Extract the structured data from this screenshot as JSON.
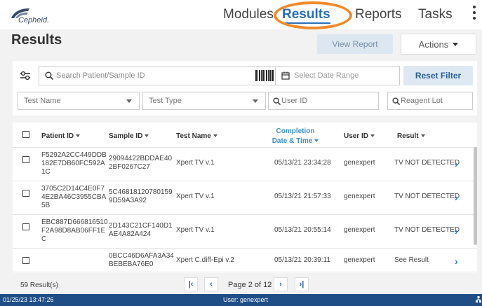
{
  "brand": {
    "name": "Cepheid."
  },
  "nav": {
    "items": [
      {
        "label": "Modules"
      },
      {
        "label": "Results"
      },
      {
        "label": "Reports"
      },
      {
        "label": "Tasks"
      }
    ],
    "active": "Results"
  },
  "page": {
    "title": "Results",
    "view_report_label": "View Report",
    "actions_label": "Actions"
  },
  "filters": {
    "search_placeholder": "Search Patient/Sample ID",
    "date_placeholder": "Select Date Range",
    "reset_label": "Reset Filter",
    "test_name_label": "Test Name",
    "test_type_label": "Test Type",
    "user_id_placeholder": "User ID",
    "reagent_lot_placeholder": "Reagent Lot"
  },
  "table": {
    "columns": [
      {
        "label": "Patient ID"
      },
      {
        "label": "Sample ID"
      },
      {
        "label": "Test Name"
      },
      {
        "label_line1": "Completion",
        "label_line2": "Date & Time"
      },
      {
        "label": "User ID"
      },
      {
        "label": "Result"
      }
    ],
    "rows": [
      {
        "patient_id": [
          "F5292A2CC449DDB",
          "182E7DB60FC592A",
          "1C"
        ],
        "sample_id": [
          "29094422BDDAE40",
          "2BF0267C27"
        ],
        "test_name": "Xpert TV v.1",
        "completion": "05/13/21 23:34:28",
        "user_id": "genexpert",
        "result": "TV NOT DETECTED"
      },
      {
        "patient_id": [
          "3705C2D14C4E0F7",
          "4E2BA46C3955CBA",
          "5B"
        ],
        "sample_id": [
          "5C46818120780159",
          "9D59A3A92"
        ],
        "test_name": "Xpert TV v.1",
        "completion": "05/13/21 21:57:33",
        "user_id": "genexpert",
        "result": "TV NOT DETECTED"
      },
      {
        "patient_id": [
          "EBC887D666816510",
          "F2A98D8AB06FF1E",
          "C"
        ],
        "sample_id": [
          "2D143C21CF140D1",
          "AE4A82A424"
        ],
        "test_name": "Xpert TV v.1",
        "completion": "05/13/21 20:55:14",
        "user_id": "genexpert",
        "result": "TV NOT DETECTED"
      },
      {
        "patient_id": [],
        "sample_id": [
          "0BCC46D6AFA3A34",
          "BEBEBA76E0"
        ],
        "test_name": "Xpert C.diff-Epi v.2",
        "completion": "05/13/21 20:39:11",
        "user_id": "genexpert",
        "result": "See Result"
      }
    ]
  },
  "pager": {
    "results_count": "59 Result(s)",
    "page_label": "Page 2 of 12"
  },
  "status": {
    "timestamp": "01/25/23 13:47:26",
    "user": "User: genexpert"
  },
  "colors": {
    "accent": "#2a6fbd",
    "highlight_circle": "#ef8b2a",
    "status_bar": "#1f4d86"
  }
}
